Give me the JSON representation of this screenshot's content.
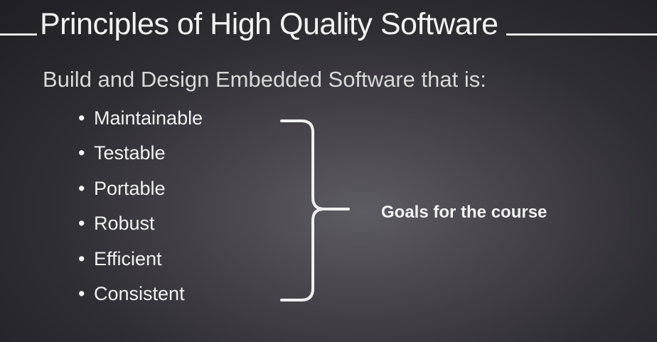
{
  "slide": {
    "title": "Principles of High Quality Software",
    "subtitle": "Build and Design Embedded Software that is:",
    "bullet_glyph": "•",
    "bullets": [
      "Maintainable",
      "Testable",
      "Portable",
      "Robust",
      "Efficient",
      "Consistent"
    ],
    "annotation": "Goals for the course"
  },
  "colors": {
    "background_center": "#5e5c63",
    "background_edge": "#1f1e22",
    "text": "#f2f2f2",
    "brace": "#f0f0f0"
  },
  "icons": {
    "brace": "right-curly-brace-icon"
  }
}
